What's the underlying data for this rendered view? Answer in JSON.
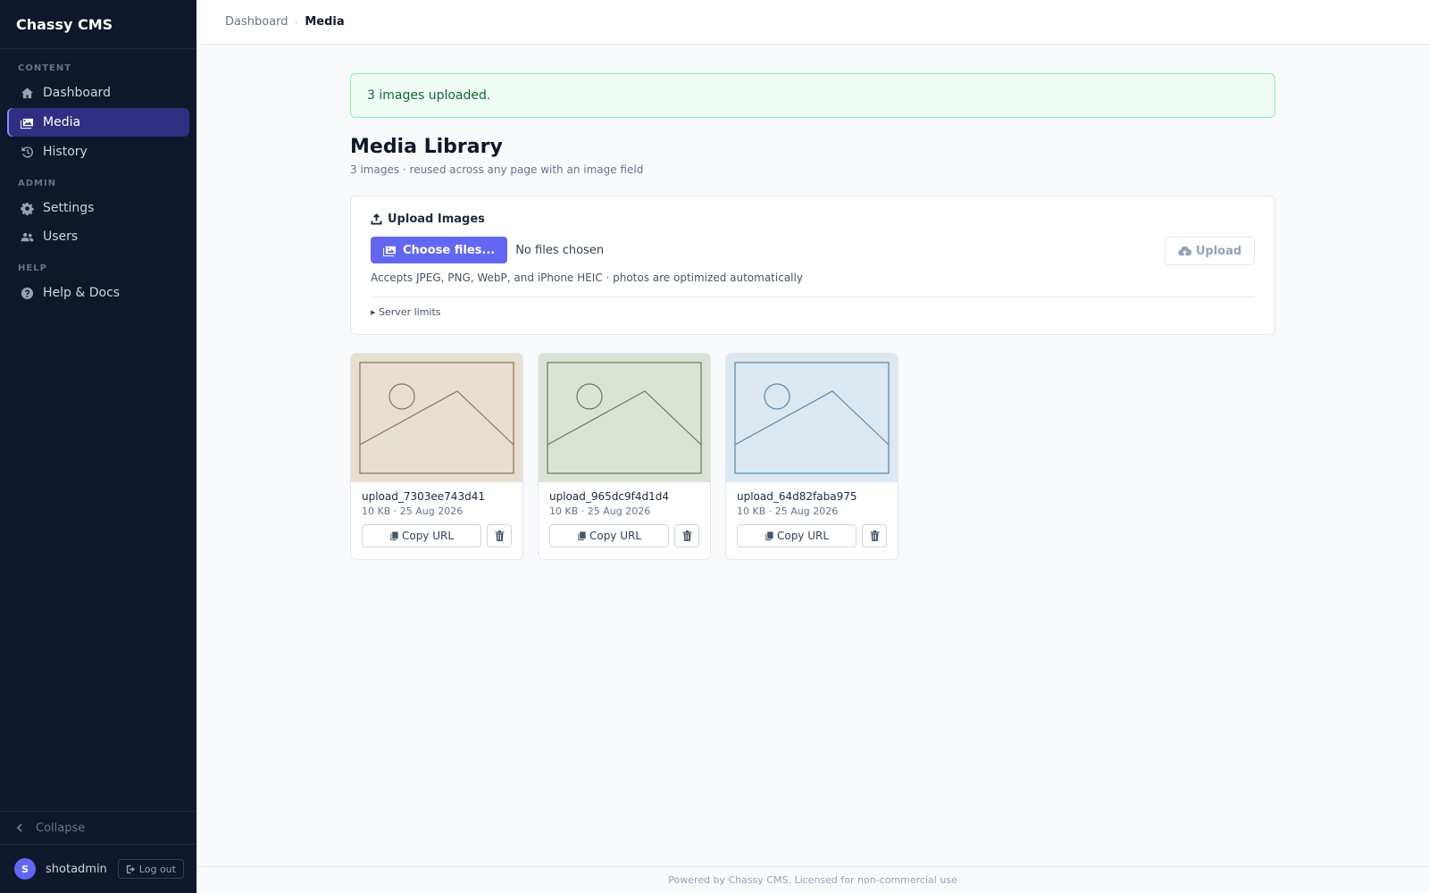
{
  "app": {
    "name": "Chassy CMS"
  },
  "sidebar": {
    "sections": [
      {
        "label": "CONTENT"
      },
      {
        "label": "ADMIN"
      },
      {
        "label": "HELP"
      }
    ],
    "items": [
      {
        "label": "Dashboard",
        "icon": "home-icon"
      },
      {
        "label": "Media",
        "icon": "images-icon",
        "active": true
      },
      {
        "label": "History",
        "icon": "history-icon"
      },
      {
        "label": "Settings",
        "icon": "gear-icon"
      },
      {
        "label": "Users",
        "icon": "users-icon"
      },
      {
        "label": "Help & Docs",
        "icon": "help-circle-icon"
      }
    ],
    "collapse_label": "Collapse",
    "user": {
      "initial": "S",
      "name": "shotadmin",
      "logout_label": "Log out"
    }
  },
  "breadcrumb": {
    "parent": "Dashboard",
    "current": "Media"
  },
  "alert": {
    "message": "3 images uploaded."
  },
  "page": {
    "title": "Media Library",
    "subtitle": "3 images · reused across any page with an image field"
  },
  "upload": {
    "heading": "Upload Images",
    "choose_label": "Choose files...",
    "no_files": "No files chosen",
    "upload_label": "Upload",
    "accepts": "Accepts JPEG, PNG, WebP, and iPhone HEIC · photos are optimized automatically",
    "server_limits": "▸ Server limits"
  },
  "media": [
    {
      "name": "upload_7303ee743d41",
      "meta": "10 KB · 25 Aug 2026",
      "copy_label": "Copy URL",
      "bg": "#e6dfd2",
      "stroke": "#8b7550"
    },
    {
      "name": "upload_965dc9f4d1d4",
      "meta": "10 KB · 25 Aug 2026",
      "copy_label": "Copy URL",
      "bg": "#dbe3d7",
      "stroke": "#5f7d5e"
    },
    {
      "name": "upload_64d82faba975",
      "meta": "10 KB · 25 Aug 2026",
      "copy_label": "Copy URL",
      "bg": "#dee8f0",
      "stroke": "#5a88aa"
    }
  ],
  "footer": {
    "text": "Powered by Chassy CMS. Licensed for non-commercial use"
  },
  "colors": {
    "sidebar_bg": "#0f172a",
    "accent": "#6366f1",
    "active_bg": "#312e81",
    "success_bg": "#f0fdf4",
    "success_text": "#166534"
  }
}
